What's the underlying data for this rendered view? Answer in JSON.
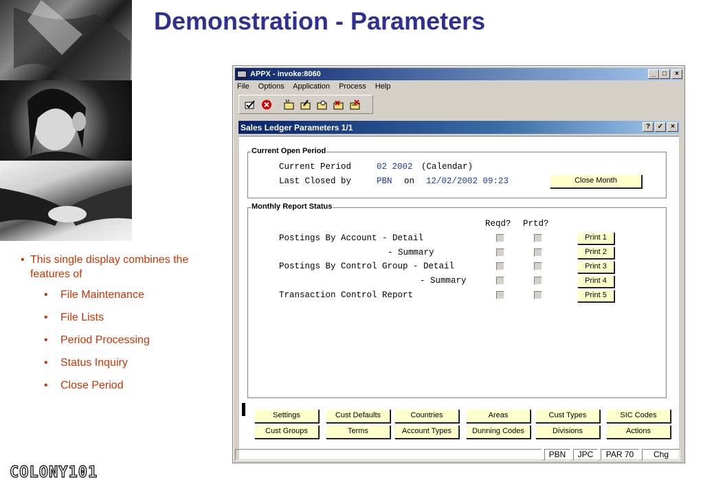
{
  "slide": {
    "title": "Demonstration - Parameters",
    "bullet_main": "This single display combines the features of",
    "bullets": [
      "File Maintenance",
      "File Lists",
      "Period Processing",
      "Status Inquiry",
      "Close Period"
    ],
    "logo": "COLONY101"
  },
  "window": {
    "title": "APPX - invoke:8060",
    "controls": [
      "_",
      "□",
      "×"
    ],
    "menu": [
      "File",
      "Options",
      "Application",
      "Process",
      "Help"
    ],
    "toolbar_icons": [
      "check-tool-icon",
      "cancel-tool-icon",
      "new-tool-icon",
      "edit-tool-icon",
      "search-tool-icon",
      "delete-tool-icon",
      "delete-all-tool-icon"
    ]
  },
  "form": {
    "title": "Sales Ledger Parameters 1/1",
    "title_buttons": [
      "?",
      "✓",
      "×"
    ],
    "current_group_label": "Current Open Period",
    "current_period_label": "Current Period",
    "current_period_value": "02 2002",
    "current_period_type": "(Calendar)",
    "last_closed_label": "Last Closed by",
    "last_closed_user": "PBN",
    "on_label": "on",
    "last_closed_datetime": "12/02/2002 09:23",
    "close_month_button": "Close Month",
    "monthly_group_label": "Monthly Report Status",
    "col_reqd": "Reqd?",
    "col_prtd": "Prtd?",
    "reports": [
      {
        "label": "Postings By Account - Detail",
        "button": "Print 1",
        "reqd": false,
        "prtd": false
      },
      {
        "label": "- Summary",
        "button": "Print 2",
        "reqd": false,
        "prtd": false
      },
      {
        "label": "Postings By Control Group - Detail",
        "button": "Print 3",
        "reqd": false,
        "prtd": false
      },
      {
        "label": "- Summary",
        "button": "Print 4",
        "reqd": false,
        "prtd": false
      },
      {
        "label": "Transaction Control Report",
        "button": "Print 5",
        "reqd": false,
        "prtd": false
      }
    ],
    "bottom_buttons_row1": [
      "Settings",
      "Cust Defaults",
      "Countries",
      "Areas",
      "Cust Types",
      "SIC Codes"
    ],
    "bottom_buttons_row2": [
      "Cust Groups",
      "Terms",
      "Account Types",
      "Dunning Codes",
      "Divisions",
      "Actions"
    ]
  },
  "statusbar": [
    "PBN",
    "JPC",
    "PAR 70",
    "Chg"
  ]
}
